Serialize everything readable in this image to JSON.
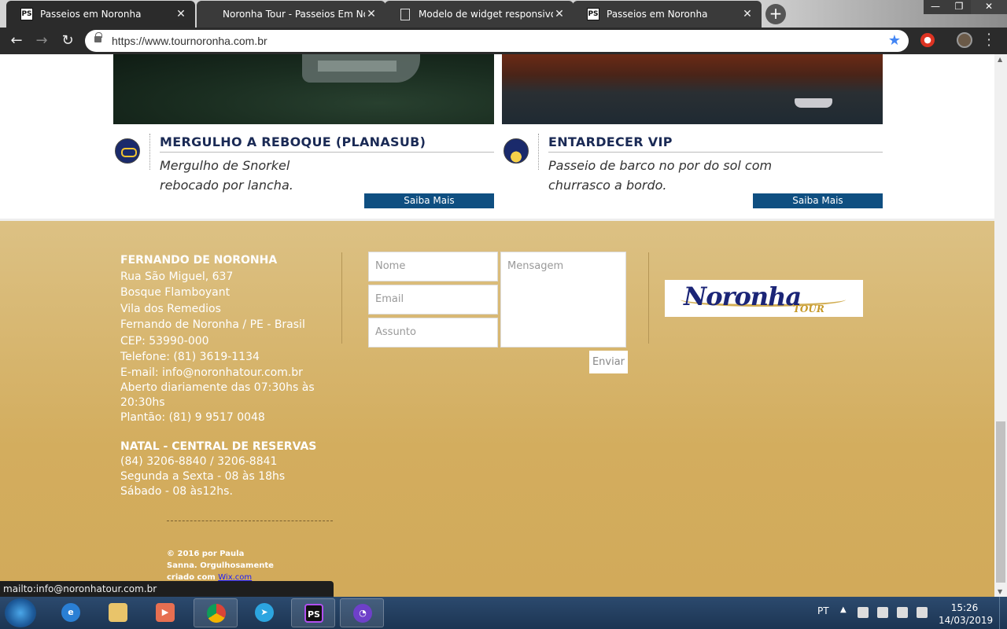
{
  "browser": {
    "tabs": [
      {
        "label": "Passeios em Noronha",
        "icon": "ps-icon"
      },
      {
        "label": "Noronha Tour - Passeios Em Noronha",
        "icon": "none"
      },
      {
        "label": "Modelo de widget responsivo pl",
        "icon": "document-icon"
      },
      {
        "label": "Passeios em Noronha",
        "icon": "ps-icon"
      }
    ],
    "new_tab": "+",
    "window_buttons": {
      "minimize": "—",
      "restore": "❐",
      "close": "✕"
    },
    "url": "https://www.tournoronha.com.br",
    "status_link": "mailto:info@noronhatour.com.br"
  },
  "cards": [
    {
      "title": "MERGULHO A REBOQUE (PLANASUB)",
      "desc": "Mergulho de Snorkel rebocado por lancha.",
      "button": "Saiba Mais"
    },
    {
      "title": "ENTARDECER VIP",
      "desc": "Passeio de barco no por do sol com churrasco a bordo.",
      "button": "Saiba Mais"
    }
  ],
  "footer": {
    "office1": {
      "title": "FERNANDO DE NORONHA",
      "lines": [
        "Rua São Miguel, 637",
        "Bosque Flamboyant",
        "Vila dos Remedios",
        "Fernando de Noronha / PE - Brasil",
        "CEP: 53990-000",
        "Telefone: (81) 3619-1134",
        "E-mail: info@noronhatour.com.br",
        "Aberto diariamente das 07:30hs às 20:30hs",
        "Plantão: (81) 9 9517 0048"
      ]
    },
    "office2": {
      "title": "NATAL - CENTRAL DE RESERVAS",
      "lines": [
        "(84) 3206-8840 / 3206-8841",
        "Segunda a Sexta - 08 às 18hs",
        "Sábado - 08 às12hs."
      ]
    },
    "form": {
      "name_placeholder": "Nome",
      "email_placeholder": "Email",
      "subject_placeholder": "Assunto",
      "message_placeholder": "Mensagem",
      "send": "Enviar"
    },
    "logo": {
      "word": "Noronha",
      "sub": "TOUR"
    },
    "copyright": "© 2016 por Paula Sanna. Orgulhosamente criado com",
    "copyright_link": "Wix.com"
  },
  "taskbar": {
    "lang": "PT",
    "time": "15:26",
    "date": "14/03/2019",
    "apps": [
      "windows-explorer",
      "internet-explorer",
      "file-explorer",
      "media-player",
      "chrome",
      "telegram",
      "phpstorm",
      "github-desktop"
    ]
  },
  "colors": {
    "card_title": "#1a2a55",
    "button_bg": "#0f4f81",
    "footer_gold": "#d3ad5e"
  }
}
